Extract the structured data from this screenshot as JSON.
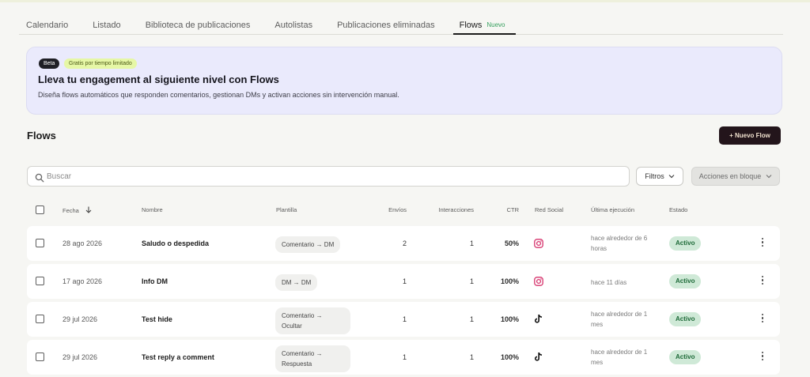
{
  "tabs": [
    {
      "label": "Calendario"
    },
    {
      "label": "Listado"
    },
    {
      "label": "Biblioteca de publicaciones"
    },
    {
      "label": "Autolistas"
    },
    {
      "label": "Publicaciones eliminadas"
    },
    {
      "label": "Flows",
      "badge": "Nuevo"
    }
  ],
  "banner": {
    "beta": "Beta",
    "free": "Gratis por tiempo limitado",
    "title": "Lleva tu engagement al siguiente nivel con Flows",
    "description": "Diseña flows automáticos que responden comentarios, gestionan DMs y activan acciones sin intervención manual."
  },
  "section": {
    "title": "Flows",
    "new_button": "+ Nuevo Flow"
  },
  "search": {
    "placeholder": "Buscar",
    "value": ""
  },
  "toolbar": {
    "filters": "Filtros",
    "bulk_actions": "Acciones en bloque"
  },
  "columns": {
    "date": "Fecha",
    "name": "Nombre",
    "template": "Plantilla",
    "sends": "Envíos",
    "interactions": "Interacciones",
    "ctr": "CTR",
    "social": "Red Social",
    "last_run": "Última ejecución",
    "status": "Estado"
  },
  "rows": [
    {
      "date": "28 ago 2026",
      "name": "Saludo o despedida",
      "template": "Comentario → DM",
      "sends": "2",
      "interactions": "1",
      "ctr": "50%",
      "social": "instagram-icon",
      "last_run": "hace alrededor de 6 horas",
      "status": "Activo"
    },
    {
      "date": "17 ago 2026",
      "name": "Info DM",
      "template": "DM → DM",
      "sends": "1",
      "interactions": "1",
      "ctr": "100%",
      "social": "instagram-icon",
      "last_run": "hace 11 días",
      "status": "Activo"
    },
    {
      "date": "29 jul 2026",
      "name": "Test hide",
      "template": "Comentario → Ocultar",
      "sends": "1",
      "interactions": "1",
      "ctr": "100%",
      "social": "tiktok-icon",
      "last_run": "hace alrededor de 1 mes",
      "status": "Activo"
    },
    {
      "date": "29 jul 2026",
      "name": "Test reply a comment",
      "template": "Comentario → Respuesta",
      "sends": "1",
      "interactions": "1",
      "ctr": "100%",
      "social": "tiktok-icon",
      "last_run": "hace alrededor de 1 mes",
      "status": "Activo"
    }
  ],
  "colors": {
    "accent_dark": "#23151b",
    "banner_bg": "#eaeafc",
    "status_active_bg": "#cfe9d7",
    "status_active_text": "#1d6a38",
    "instagram": "#d6336c",
    "new_badge": "#37a05f"
  }
}
